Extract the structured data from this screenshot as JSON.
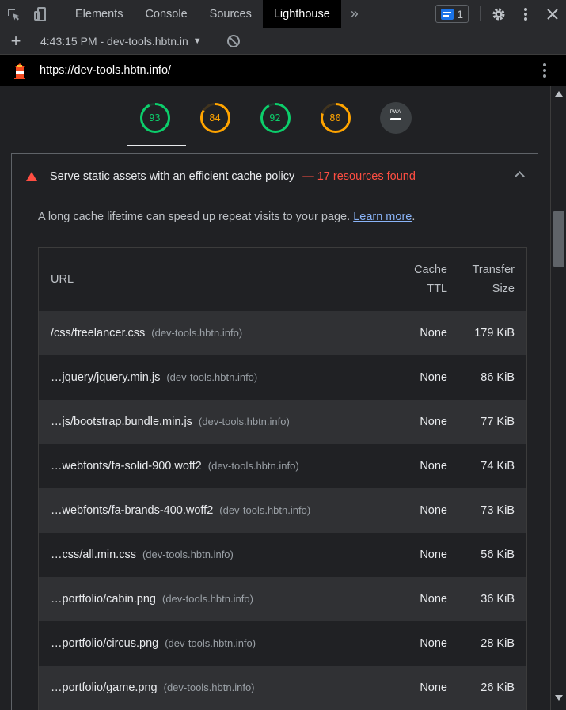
{
  "tabs": {
    "items": [
      {
        "label": "Elements"
      },
      {
        "label": "Console"
      },
      {
        "label": "Sources"
      },
      {
        "label": "Lighthouse"
      }
    ],
    "issues_count": "1"
  },
  "toolbar": {
    "report_label": "4:43:15 PM - dev-tools.hbtn.in"
  },
  "urlbar": {
    "url": "https://dev-tools.hbtn.info/"
  },
  "gauges": [
    {
      "value": "93",
      "score": 0.93,
      "color": "#0cce6b"
    },
    {
      "value": "84",
      "score": 0.84,
      "color": "#ffa400"
    },
    {
      "value": "92",
      "score": 0.92,
      "color": "#0cce6b"
    },
    {
      "value": "80",
      "score": 0.8,
      "color": "#ffa400"
    }
  ],
  "pwa": {
    "label": "PWA"
  },
  "audit": {
    "title": "Serve static assets with an efficient cache policy",
    "display_value": "— 17 resources found",
    "description": "A long cache lifetime can speed up repeat visits to your page.",
    "learn_more": "Learn more",
    "table": {
      "headers": {
        "url": "URL",
        "ttl_line1": "Cache",
        "ttl_line2": "TTL",
        "size_line1": "Transfer",
        "size_line2": "Size"
      },
      "rows": [
        {
          "url": "/css/freelancer.css",
          "host": "(dev-tools.hbtn.info)",
          "ttl": "None",
          "size": "179 KiB"
        },
        {
          "url": "…jquery/jquery.min.js",
          "host": "(dev-tools.hbtn.info)",
          "ttl": "None",
          "size": "86 KiB"
        },
        {
          "url": "…js/bootstrap.bundle.min.js",
          "host": "(dev-tools.hbtn.info)",
          "ttl": "None",
          "size": "77 KiB"
        },
        {
          "url": "…webfonts/fa-solid-900.woff2",
          "host": "(dev-tools.hbtn.info)",
          "ttl": "None",
          "size": "74 KiB"
        },
        {
          "url": "…webfonts/fa-brands-400.woff2",
          "host": "(dev-tools.hbtn.info)",
          "ttl": "None",
          "size": "73 KiB"
        },
        {
          "url": "…css/all.min.css",
          "host": "(dev-tools.hbtn.info)",
          "ttl": "None",
          "size": "56 KiB"
        },
        {
          "url": "…portfolio/cabin.png",
          "host": "(dev-tools.hbtn.info)",
          "ttl": "None",
          "size": "36 KiB"
        },
        {
          "url": "…portfolio/circus.png",
          "host": "(dev-tools.hbtn.info)",
          "ttl": "None",
          "size": "28 KiB"
        },
        {
          "url": "…portfolio/game.png",
          "host": "(dev-tools.hbtn.info)",
          "ttl": "None",
          "size": "26 KiB"
        }
      ]
    }
  }
}
